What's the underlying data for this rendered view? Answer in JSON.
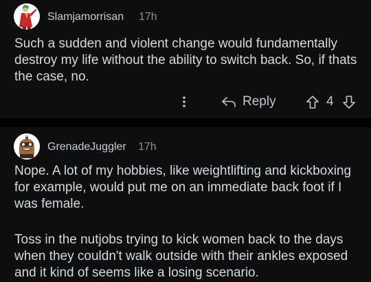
{
  "comments": [
    {
      "username": "Slamjamorrisan",
      "age": "17h",
      "text": "Such a sudden and violent change would fundamentally destroy my life without the ability to switch back. So, if thats the case, no.",
      "actions": {
        "more_icon": "more-vertical-icon",
        "reply_icon": "reply-arrow-icon",
        "reply_label": "Reply",
        "upvote_icon": "upvote-arrow-icon",
        "score": "4",
        "downvote_icon": "downvote-arrow-icon"
      }
    },
    {
      "username": "GrenadeJuggler",
      "age": "17h",
      "paragraphs": [
        "Nope. A lot of my hobbies, like weightlifting and kickboxing for example, would put me on an immediate back foot if I was female.",
        "Toss in the nutjobs trying to kick women back to the days when they couldn't walk outside with their ankles exposed and it kind of seems like a losing scenario."
      ]
    }
  ],
  "colors": {
    "background": "#000000",
    "card": "#0e0e0e",
    "text": "#d7dadc",
    "muted": "#8b8e91"
  }
}
